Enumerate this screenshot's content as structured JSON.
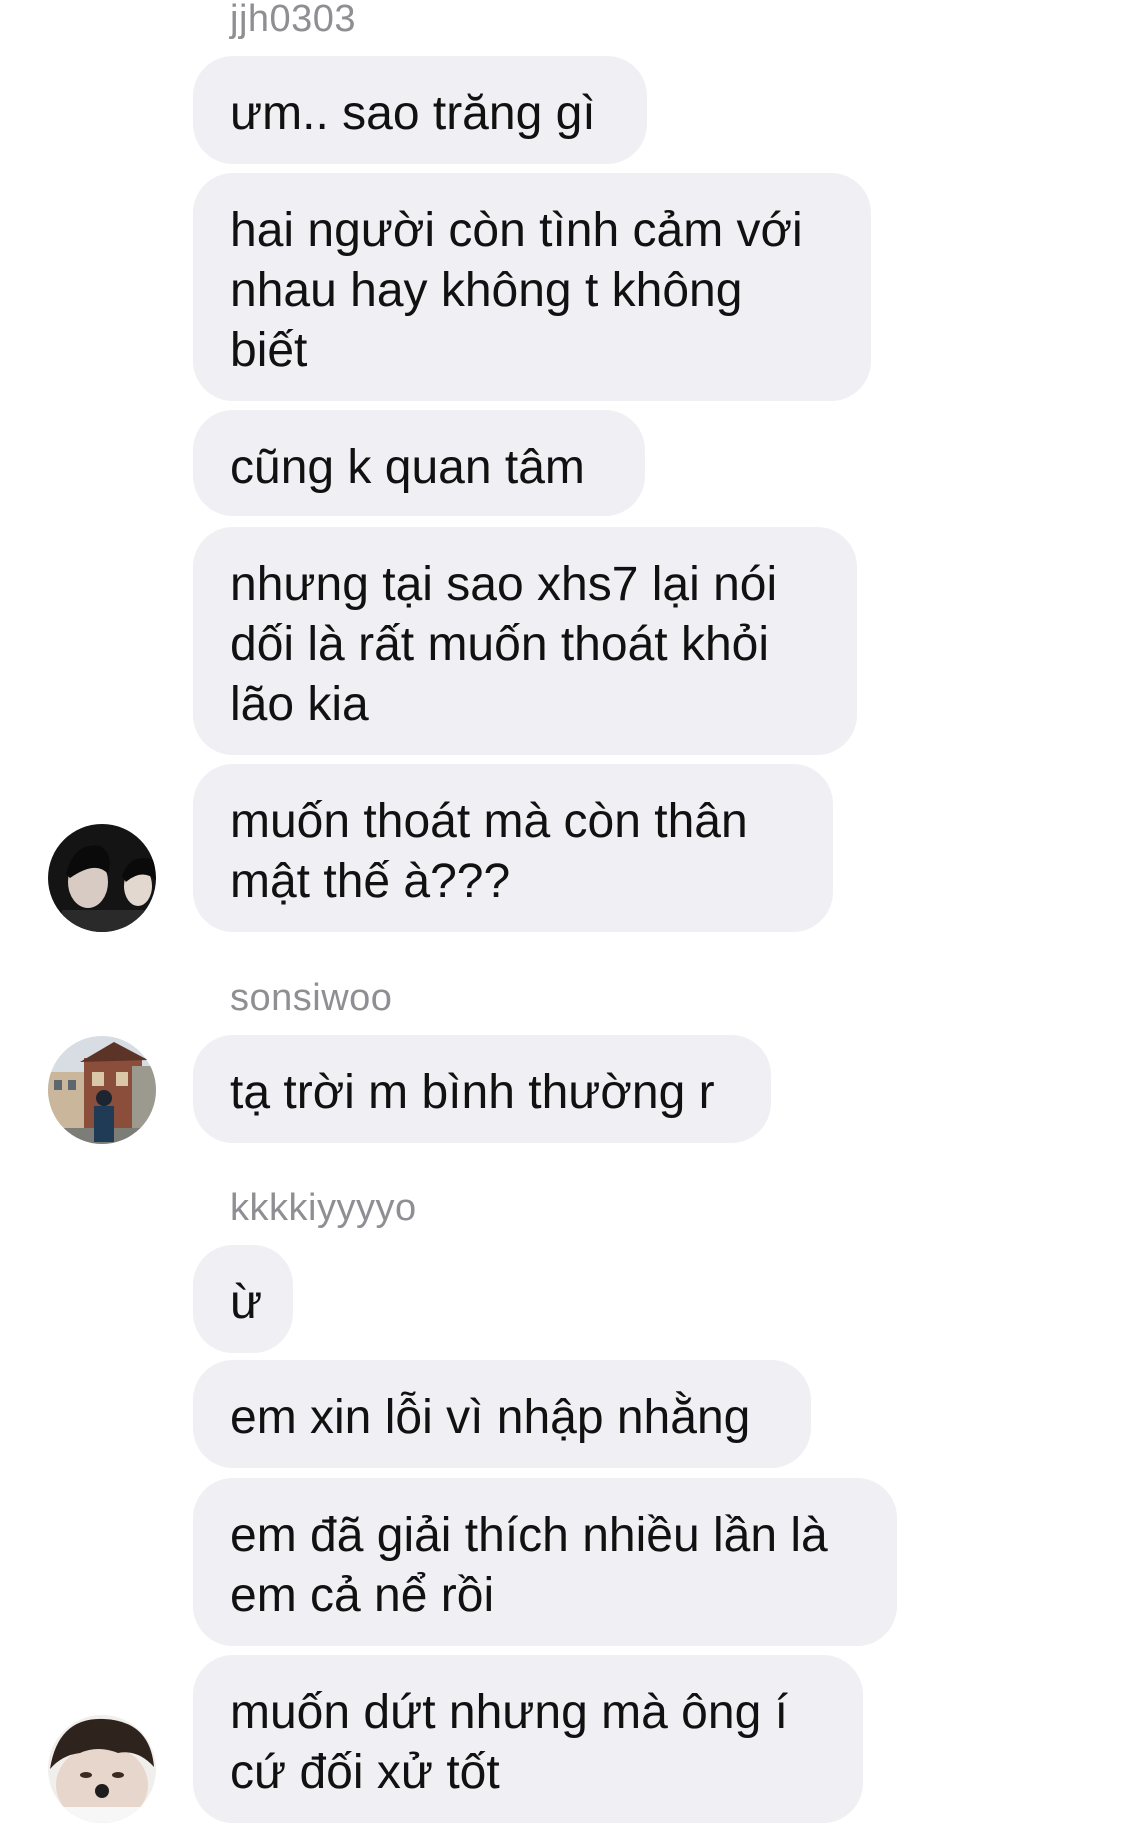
{
  "messages": [
    {
      "sender": "jjh0303"
    },
    {
      "text": "ưm.. sao trăng gì"
    },
    {
      "text": "hai người còn tình cảm với\nnhau hay không t không\nbiết"
    },
    {
      "text": "cũng k quan tâm"
    },
    {
      "text": "nhưng tại sao xhs7 lại nói\ndối là rất muốn thoát khỏi\nlão kia"
    },
    {
      "text": "muốn thoát mà còn thân\nmật thế à???"
    },
    {
      "sender": "sonsiwoo"
    },
    {
      "text": "tạ trời m bình thường r"
    },
    {
      "sender": "kkkkiyyyyo"
    },
    {
      "text": "ừ"
    },
    {
      "text": "em xin lỗi vì nhập nhằng"
    },
    {
      "text": "em đã giải thích nhiều lần là\nem cả nể rồi"
    },
    {
      "text": "muốn dứt nhưng mà ông í\ncứ đối xử tốt"
    }
  ],
  "colors": {
    "bubble": "#efeff4",
    "sender": "#8e8e93",
    "text": "#111111",
    "background": "#ffffff"
  }
}
